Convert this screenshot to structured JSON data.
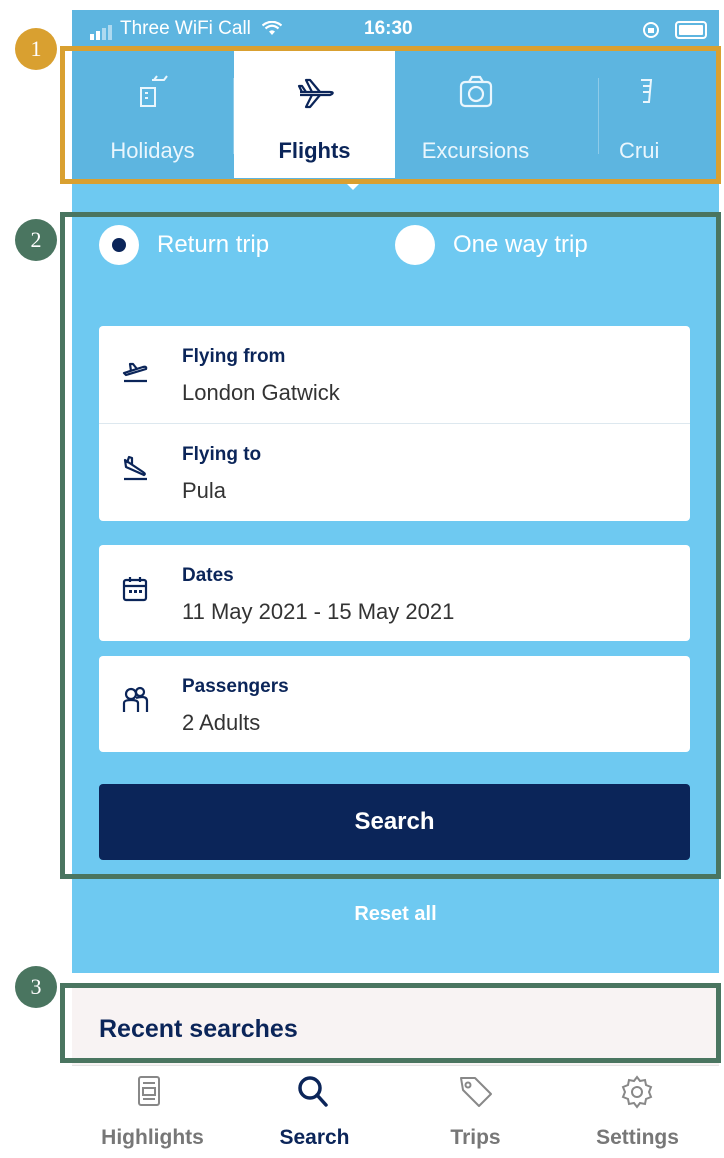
{
  "status_bar": {
    "carrier": "Three WiFi Call",
    "time": "16:30"
  },
  "tabs": [
    {
      "label": "Holidays",
      "icon": "holiday-icon",
      "active": false
    },
    {
      "label": "Flights",
      "icon": "plane-icon",
      "active": true
    },
    {
      "label": "Excursions",
      "icon": "camera-icon",
      "active": false
    },
    {
      "label": "Crui",
      "icon": "cruise-icon",
      "active": false
    }
  ],
  "trip_type": {
    "return_label": "Return trip",
    "one_way_label": "One way trip",
    "selected": "return"
  },
  "fields": {
    "from": {
      "label": "Flying from",
      "value": "London Gatwick"
    },
    "to": {
      "label": "Flying to",
      "value": "Pula"
    },
    "dates": {
      "label": "Dates",
      "value": "11 May 2021 - 15 May 2021"
    },
    "passengers": {
      "label": "Passengers",
      "value": "2 Adults"
    }
  },
  "search_label": "Search",
  "reset_label": "Reset all",
  "recent_title": "Recent searches",
  "bottom_nav": [
    {
      "label": "Highlights",
      "icon": "highlights-icon",
      "active": false
    },
    {
      "label": "Search",
      "icon": "search-icon",
      "active": true
    },
    {
      "label": "Trips",
      "icon": "tag-icon",
      "active": false
    },
    {
      "label": "Settings",
      "icon": "gear-icon",
      "active": false
    }
  ],
  "annotations": [
    "1",
    "2",
    "3"
  ],
  "colors": {
    "navy": "#0b2559",
    "sky": "#6ec9f1",
    "tab_blue": "#5db5e0",
    "annotation_1": "#d9a030",
    "annotation_2": "#4a7560",
    "annotation_3": "#4a7560"
  }
}
